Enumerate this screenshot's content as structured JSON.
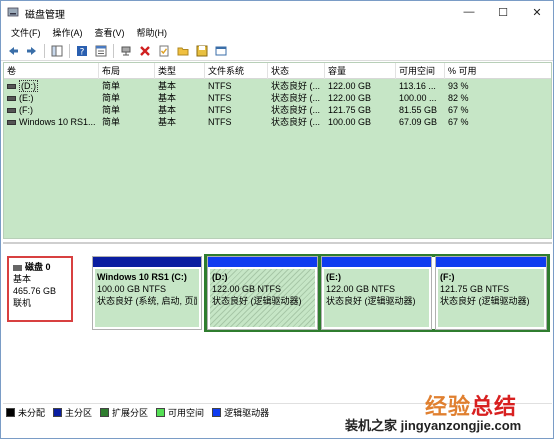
{
  "window": {
    "title": "磁盘管理",
    "controls": {
      "minimize": "—",
      "maximize": "☐",
      "close": "✕"
    }
  },
  "menu": [
    "文件(F)",
    "操作(A)",
    "查看(V)",
    "帮助(H)"
  ],
  "toolbar": {
    "icons": [
      "back-arrow-icon",
      "forward-arrow-icon",
      "console-tree-icon",
      "help-icon",
      "properties-list-icon",
      "connect-icon",
      "delete-x-icon",
      "check-document-icon",
      "folder-icon",
      "save-icon",
      "window-icon"
    ]
  },
  "table": {
    "columns": [
      "卷",
      "布局",
      "类型",
      "文件系统",
      "状态",
      "容量",
      "可用空间",
      "% 可用"
    ],
    "rows": [
      {
        "volume": "(D:)",
        "layout": "简单",
        "type": "基本",
        "fs": "NTFS",
        "status": "状态良好 (...",
        "capacity": "122.00 GB",
        "free": "113.16 ...",
        "pct": "93 %",
        "selected": true
      },
      {
        "volume": "(E:)",
        "layout": "简单",
        "type": "基本",
        "fs": "NTFS",
        "status": "状态良好 (...",
        "capacity": "122.00 GB",
        "free": "100.00 ...",
        "pct": "82 %",
        "selected": false
      },
      {
        "volume": "(F:)",
        "layout": "简单",
        "type": "基本",
        "fs": "NTFS",
        "status": "状态良好 (...",
        "capacity": "121.75 GB",
        "free": "81.55 GB",
        "pct": "67 %",
        "selected": false
      },
      {
        "volume": "Windows 10 RS1...",
        "layout": "简单",
        "type": "基本",
        "fs": "NTFS",
        "status": "状态良好 (...",
        "capacity": "100.00 GB",
        "free": "67.09 GB",
        "pct": "67 %",
        "selected": false
      }
    ]
  },
  "disk": {
    "name": "磁盘 0",
    "type": "基本",
    "size": "465.76 GB",
    "state": "联机",
    "partitions": [
      {
        "title": "Windows 10 RS1  (C:)",
        "size": "100.00 GB NTFS",
        "status": "状态良好 (系统, 启动, 页面",
        "kind": "primary"
      },
      {
        "title": "(D:)",
        "size": "122.00 GB NTFS",
        "status": "状态良好 (逻辑驱动器)",
        "kind": "logical"
      },
      {
        "title": "(E:)",
        "size": "122.00 GB NTFS",
        "status": "状态良好 (逻辑驱动器)",
        "kind": "logical"
      },
      {
        "title": "(F:)",
        "size": "121.75 GB NTFS",
        "status": "状态良好 (逻辑驱动器)",
        "kind": "logical"
      }
    ]
  },
  "legend": [
    {
      "label": "未分配",
      "color": "#000000"
    },
    {
      "label": "主分区",
      "color": "#0a1da0"
    },
    {
      "label": "扩展分区",
      "color": "#2f7d2f"
    },
    {
      "label": "可用空间",
      "color": "#55e055"
    },
    {
      "label": "逻辑驱动器",
      "color": "#0f3cf0"
    }
  ],
  "watermark": {
    "big_a": "经验",
    "big_b": "总结",
    "small": "装机之家 jingyanzongjie.com"
  }
}
